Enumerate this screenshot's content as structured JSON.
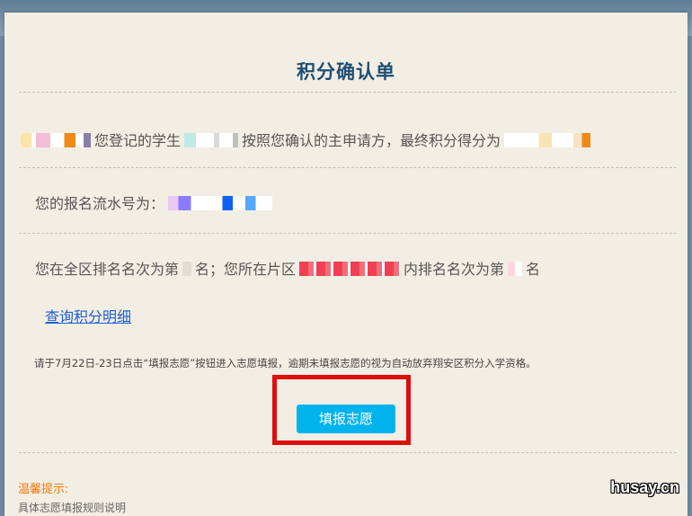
{
  "title": "积分确认单",
  "line1": {
    "part1": "您登记的学生",
    "part2": "按照您确认的主申请方，最终积分得分为"
  },
  "line2": {
    "label": "您的报名流水号为："
  },
  "line3": {
    "part1": "您在全区排名名次为第",
    "part2": "名；您所在片区",
    "part3": "内排名名次为第",
    "part4": "名"
  },
  "query_link": "查询积分明细",
  "notice": "请于7月22日-23日点击“填报志愿”按钮进入志愿填报，逾期未填报志愿的视为自动放弃翔安区积分入学资格。",
  "submit_button": "填报志愿",
  "tips": {
    "title": "温馨提示:",
    "text": "具体志愿填报规则说明"
  },
  "watermark": "husay.cn",
  "colors": {
    "title": "#1f4f73",
    "button": "#00b3ec",
    "highlight_frame": "#e00d0d",
    "tips_title": "#f57b10",
    "link": "#1e5fd0"
  }
}
